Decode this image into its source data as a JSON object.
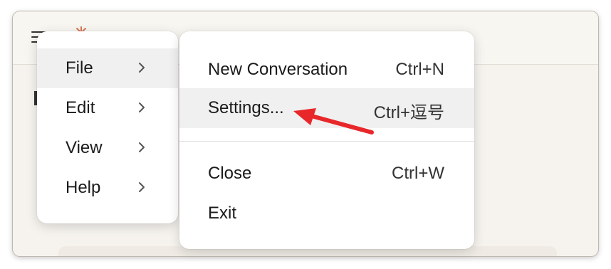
{
  "main_menu": {
    "items": [
      {
        "label": "File",
        "highlighted": true
      },
      {
        "label": "Edit"
      },
      {
        "label": "View"
      },
      {
        "label": "Help"
      }
    ]
  },
  "file_submenu": {
    "items": [
      {
        "label": "New Conversation",
        "shortcut": "Ctrl+N"
      },
      {
        "label": "Settings...",
        "shortcut": "Ctrl+逗号",
        "highlighted": true
      },
      {
        "label": "Close",
        "shortcut": "Ctrl+W"
      },
      {
        "label": "Exit",
        "shortcut": ""
      }
    ]
  },
  "annotation": {
    "arrow_color": "#e8272a"
  },
  "icons": {
    "menu": "hamburger-icon",
    "brand": "brand-icon",
    "submenu": "chevron-right-icon"
  }
}
